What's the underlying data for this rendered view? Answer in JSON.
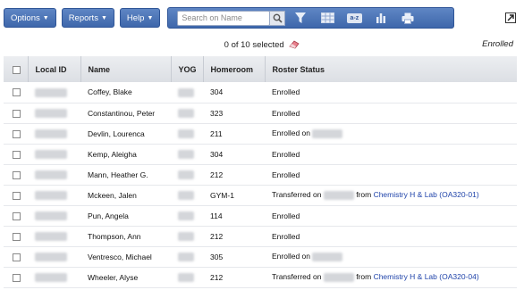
{
  "toolbar": {
    "options_label": "Options",
    "reports_label": "Reports",
    "help_label": "Help",
    "search_placeholder": "Search on Name",
    "icons": [
      "magnifier-icon",
      "filter-icon",
      "grid-icon",
      "sort-az-icon",
      "bar-chart-icon",
      "printer-icon"
    ],
    "sort_label": "a-z",
    "brand_color": "#3e67ab"
  },
  "selection": {
    "summary": "0 of 10 selected"
  },
  "status_filter": "Enrolled",
  "table": {
    "headers": {
      "local_id": "Local ID",
      "name": "Name",
      "yog": "YOG",
      "homeroom": "Homeroom",
      "roster_status": "Roster Status"
    },
    "rows": [
      {
        "name": "Coffey, Blake",
        "homeroom": "304",
        "status": "Enrolled"
      },
      {
        "name": "Constantinou, Peter",
        "homeroom": "323",
        "status": "Enrolled"
      },
      {
        "name": "Devlin, Lourenca",
        "homeroom": "211",
        "status": "Enrolled on"
      },
      {
        "name": "Kemp, Aleigha",
        "homeroom": "304",
        "status": "Enrolled"
      },
      {
        "name": "Mann, Heather G.",
        "homeroom": "212",
        "status": "Enrolled"
      },
      {
        "name": "Mckeen, Jalen",
        "homeroom": "GYM-1",
        "status": "Transferred on",
        "from": "from",
        "course": "Chemistry H & Lab (OA320-01)"
      },
      {
        "name": "Pun, Angela",
        "homeroom": "114",
        "status": "Enrolled"
      },
      {
        "name": "Thompson, Ann",
        "homeroom": "212",
        "status": "Enrolled"
      },
      {
        "name": "Ventresco, Michael",
        "homeroom": "305",
        "status": "Enrolled on"
      },
      {
        "name": "Wheeler, Alyse",
        "homeroom": "212",
        "status": "Transferred on",
        "from": "from",
        "course": "Chemistry H & Lab (OA320-04)"
      }
    ]
  }
}
